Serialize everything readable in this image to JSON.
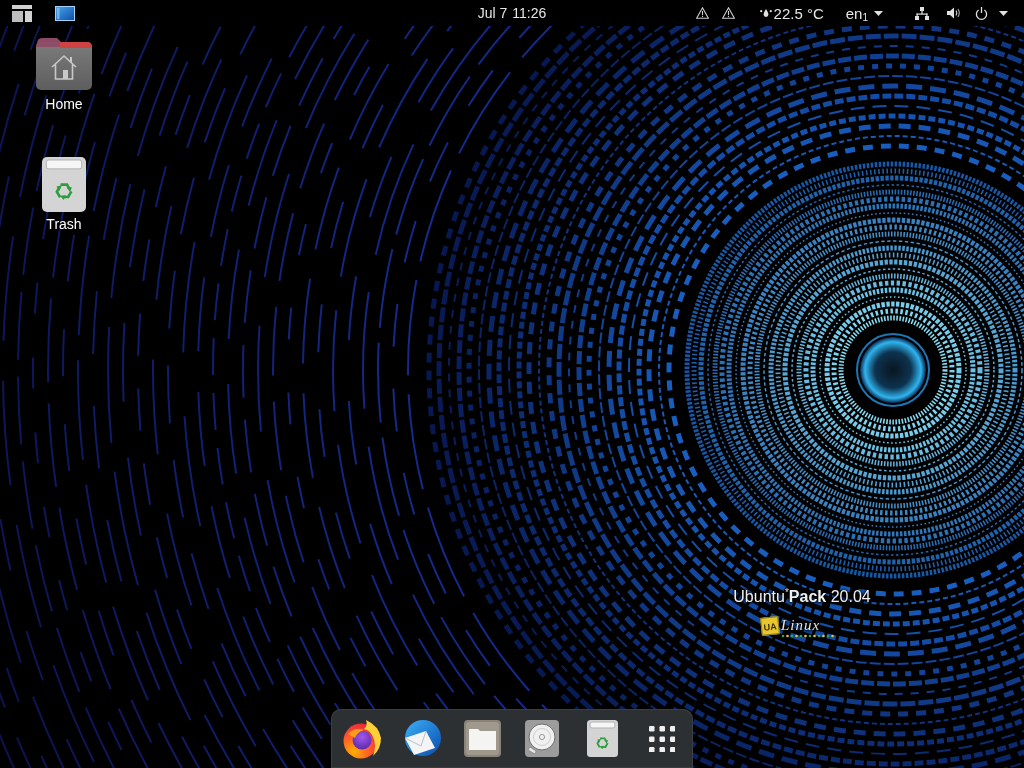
{
  "top_bar": {
    "clock": {
      "date": "Jul 7",
      "time": "11:26"
    },
    "weather": {
      "temperature": "22.5 °C"
    },
    "keyboard_layout": "en$_{1}$"
  },
  "desktop_icons": [
    {
      "label": "Home",
      "kind": "home-folder"
    },
    {
      "label": "Trash",
      "kind": "trash"
    }
  ],
  "wallpaper_logo": {
    "title": "Ubuntu$^{*}$**Pack** 20.04",
    "badge": "UA",
    "caption": "Linux"
  }
}
